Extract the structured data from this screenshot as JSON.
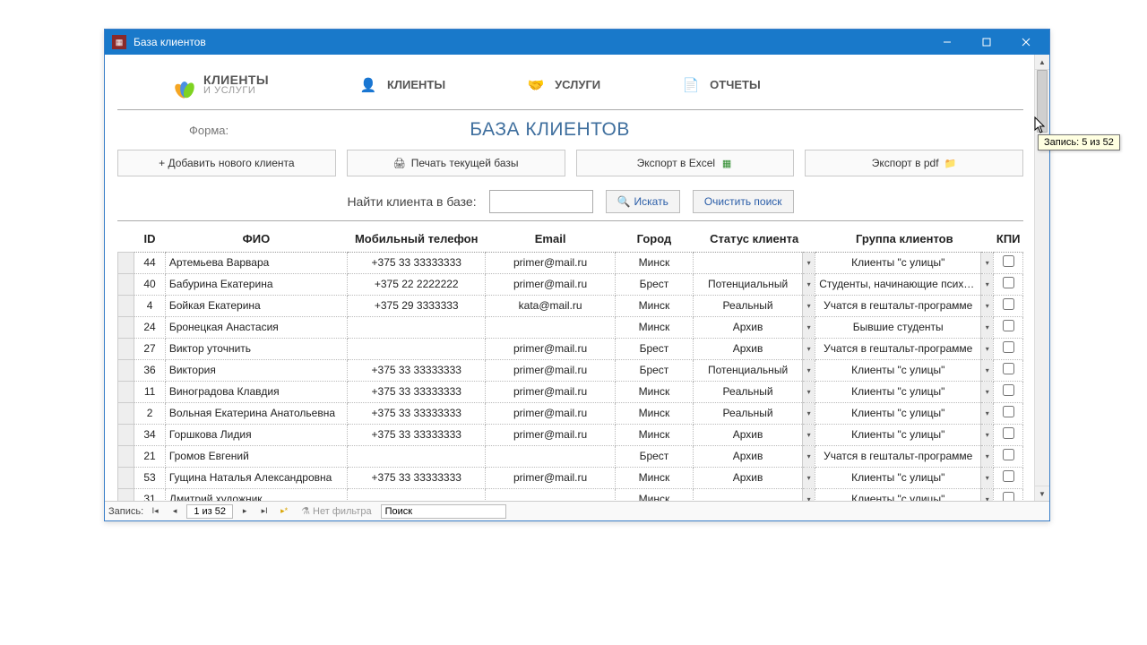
{
  "window": {
    "title": "База клиентов"
  },
  "logo": {
    "line1": "КЛИЕНТЫ",
    "line2": "И УСЛУГИ"
  },
  "nav": {
    "clients": "КЛИЕНТЫ",
    "services": "УСЛУГИ",
    "reports": "ОТЧЕТЫ"
  },
  "form_label": "Форма:",
  "page_title": "БАЗА КЛИЕНТОВ",
  "actions": {
    "add": "+ Добавить нового клиента",
    "print": "Печать текущей базы",
    "excel": "Экспорт в Excel",
    "pdf": "Экспорт в pdf"
  },
  "search": {
    "label": "Найти клиента в базе:",
    "find": "Искать",
    "clear": "Очистить поиск"
  },
  "columns": {
    "id": "ID",
    "fio": "ФИО",
    "phone": "Мобильный телефон",
    "email": "Email",
    "city": "Город",
    "status": "Статус клиента",
    "group": "Группа клиентов",
    "kpi": "КПИ"
  },
  "rows": [
    {
      "id": "44",
      "fio": "Артемьева Варвара",
      "phone": "+375 33 33333333",
      "email": "primer@mail.ru",
      "city": "Минск",
      "status": "",
      "group": "Клиенты \"с улицы\""
    },
    {
      "id": "40",
      "fio": "Бабурина Екатерина",
      "phone": "+375 22 2222222",
      "email": "primer@mail.ru",
      "city": "Брест",
      "status": "Потенциальный",
      "group": "Студенты, начинающие психологи"
    },
    {
      "id": "4",
      "fio": "Бойкая Екатерина",
      "phone": "+375 29 3333333",
      "email": "kata@mail.ru",
      "city": "Минск",
      "status": "Реальный",
      "group": "Учатся в гештальт-программе"
    },
    {
      "id": "24",
      "fio": "Бронецкая Анастасия",
      "phone": "",
      "email": "",
      "city": "Минск",
      "status": "Архив",
      "group": "Бывшие студенты"
    },
    {
      "id": "27",
      "fio": "Виктор уточнить",
      "phone": "",
      "email": "primer@mail.ru",
      "city": "Брест",
      "status": "Архив",
      "group": "Учатся в гештальт-программе"
    },
    {
      "id": "36",
      "fio": "Виктория",
      "phone": "+375 33 33333333",
      "email": "primer@mail.ru",
      "city": "Брест",
      "status": "Потенциальный",
      "group": "Клиенты \"с улицы\""
    },
    {
      "id": "11",
      "fio": "Виноградова Клавдия",
      "phone": "+375 33 33333333",
      "email": "primer@mail.ru",
      "city": "Минск",
      "status": "Реальный",
      "group": "Клиенты \"с улицы\""
    },
    {
      "id": "2",
      "fio": "Вольная Екатерина Анатольевна",
      "phone": "+375 33 33333333",
      "email": "primer@mail.ru",
      "city": "Минск",
      "status": "Реальный",
      "group": "Клиенты \"с улицы\""
    },
    {
      "id": "34",
      "fio": "Горшкова Лидия",
      "phone": "+375 33 33333333",
      "email": "primer@mail.ru",
      "city": "Минск",
      "status": "Архив",
      "group": "Клиенты \"с улицы\""
    },
    {
      "id": "21",
      "fio": "Громов Евгений",
      "phone": "",
      "email": "",
      "city": "Брест",
      "status": "Архив",
      "group": "Учатся в гештальт-программе"
    },
    {
      "id": "53",
      "fio": "Гущина Наталья Александровна",
      "phone": "+375 33 33333333",
      "email": "primer@mail.ru",
      "city": "Минск",
      "status": "Архив",
      "group": "Клиенты \"с улицы\""
    },
    {
      "id": "31",
      "fio": "Дмитрий художник",
      "phone": "",
      "email": "",
      "city": "Минск",
      "status": "",
      "group": "Клиенты \"с улицы\""
    }
  ],
  "statusbar": {
    "label": "Запись:",
    "position": "1 из 52",
    "nofilter": "Нет фильтра",
    "search_placeholder": "Поиск"
  },
  "tooltip": "Запись: 5 из 52"
}
